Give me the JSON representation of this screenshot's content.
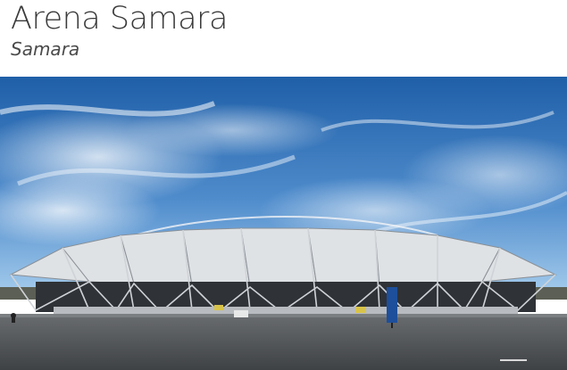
{
  "venue": {
    "name": "Arena Samara",
    "city": "Samara"
  },
  "photo": {
    "subject": "stadium-exterior",
    "colors": {
      "sky_top": "#1f5fa8",
      "sky_bottom": "#8fc0e8",
      "roof": "#c9cdd2",
      "asphalt": "#4a4d51",
      "sign": "#1e4f9a"
    }
  }
}
